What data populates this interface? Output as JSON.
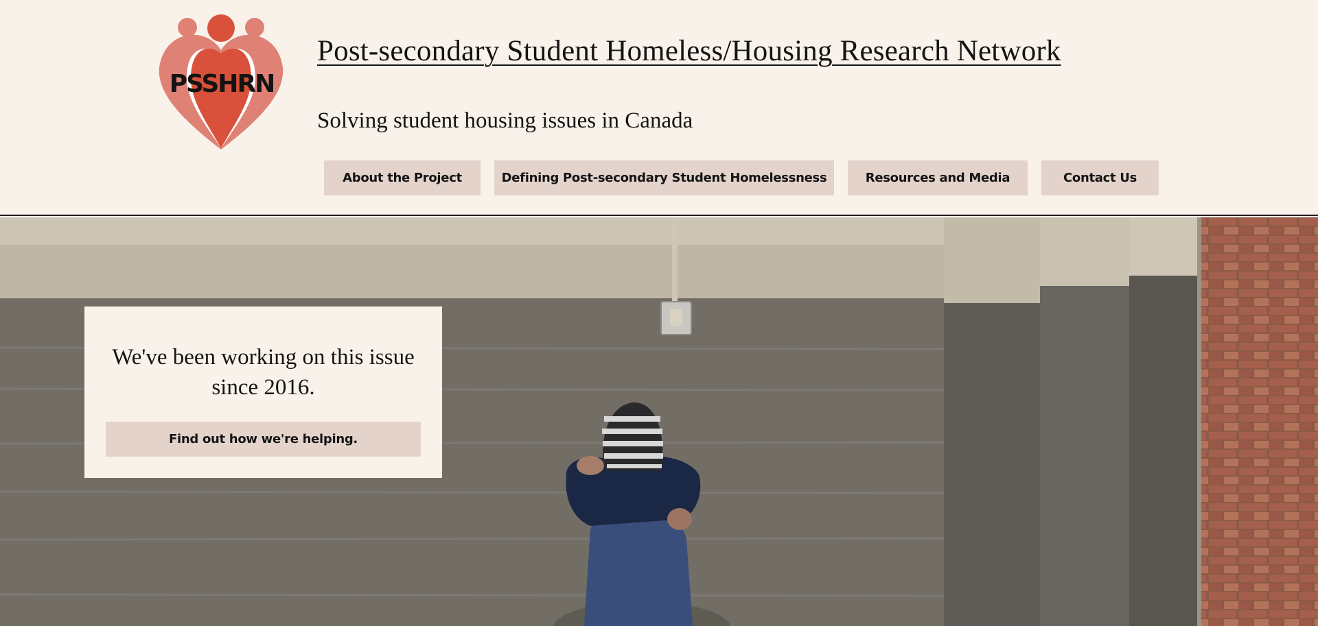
{
  "header": {
    "logo_text": "PSSHRN",
    "site_title": "Post-secondary Student Homeless/Housing Research Network",
    "tagline": "Solving student housing issues in Canada"
  },
  "nav": {
    "items": [
      {
        "label": "About the Project"
      },
      {
        "label": "Defining Post-secondary Student Homelessness"
      },
      {
        "label": "Resources and Media"
      },
      {
        "label": "Contact Us"
      }
    ]
  },
  "hero": {
    "callout_text": "We've been working on this issue since 2016.",
    "callout_button": "Find out how we're helping."
  },
  "colors": {
    "page_background": "#f9f2ea",
    "button_background": "#e3d3cb",
    "logo_red": "#d9513a",
    "logo_pink": "#df8275",
    "text": "#141414"
  }
}
